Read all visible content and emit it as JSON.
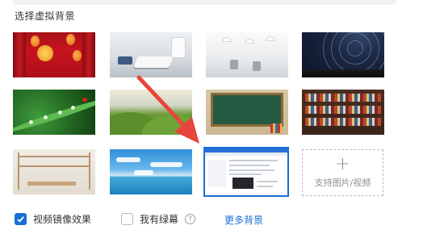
{
  "panel": {
    "title": "选择虚拟背景"
  },
  "backgrounds": [
    {
      "name": "red-festive",
      "selected": false
    },
    {
      "name": "office-meeting",
      "selected": false
    },
    {
      "name": "white-interior",
      "selected": false
    },
    {
      "name": "star-trails",
      "selected": false
    },
    {
      "name": "leaf-dew",
      "selected": false
    },
    {
      "name": "green-hills",
      "selected": false
    },
    {
      "name": "chalkboard",
      "selected": false
    },
    {
      "name": "bookshelf",
      "selected": false
    },
    {
      "name": "study-cabinet",
      "selected": false
    },
    {
      "name": "sea-sky",
      "selected": false
    },
    {
      "name": "screen-capture",
      "selected": true
    }
  ],
  "add_tile": {
    "icon": "plus-icon",
    "label": "支持图片/视频"
  },
  "options": {
    "mirror_label": "视频镜像效果",
    "mirror_checked": true,
    "greenscreen_label": "我有绿幕",
    "greenscreen_checked": false,
    "help_icon": "question-icon",
    "help_glyph": "?",
    "more_label": "更多背景"
  },
  "colors": {
    "accent": "#1a6fd4",
    "annotation_arrow": "#e8453c"
  }
}
